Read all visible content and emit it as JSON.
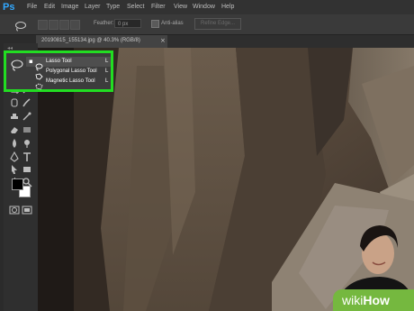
{
  "app": {
    "logo": "Ps"
  },
  "menu": {
    "items": [
      "File",
      "Edit",
      "Image",
      "Layer",
      "Type",
      "Select",
      "Filter",
      "View",
      "Window",
      "Help"
    ]
  },
  "options": {
    "feather_label": "Feather:",
    "feather_value": "0 px",
    "antialias_label": "Anti-alias",
    "refine_edge_label": "Refine Edge..."
  },
  "document": {
    "tab_title": "20190815_155134.jpg @ 40.3% (RGB/8)",
    "close_glyph": "×"
  },
  "toolbar": {
    "collapse_glyph": "◂◂"
  },
  "flyout": {
    "items": [
      {
        "label": "Lasso Tool",
        "shortcut": "L",
        "icon": "lasso-icon",
        "selected": true,
        "bullet": "▪"
      },
      {
        "label": "Polygonal Lasso Tool",
        "shortcut": "L",
        "icon": "polygonal-lasso-icon",
        "selected": false,
        "bullet": ""
      },
      {
        "label": "Magnetic Lasso Tool",
        "shortcut": "L",
        "icon": "magnetic-lasso-icon",
        "selected": false,
        "bullet": ""
      }
    ],
    "highlight_color": "#22dd22"
  },
  "colors": {
    "foreground": "#000000",
    "background": "#ffffff",
    "accent": "#31a8ff"
  },
  "watermark": {
    "prefix": "wiki",
    "suffix": "How",
    "color": "#75b83f"
  }
}
